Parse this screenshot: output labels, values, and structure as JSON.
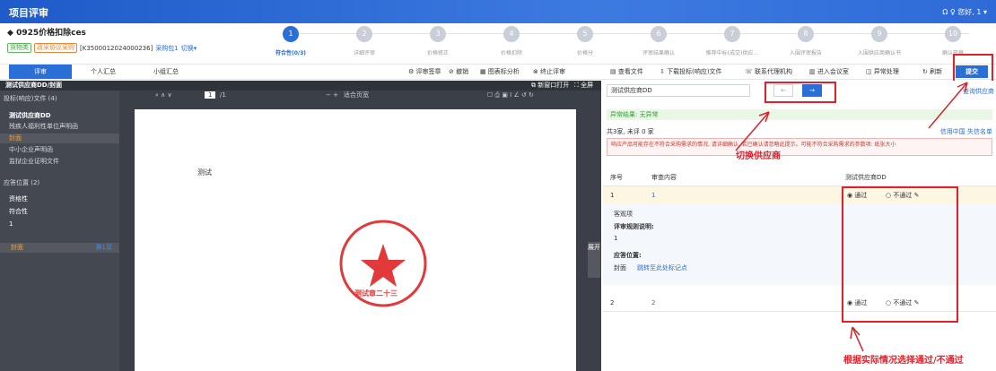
{
  "app": {
    "title": "项目评审",
    "user": "Ω  ♀ 您好, 1 ▾"
  },
  "project": {
    "name": "0925价格扣除ces",
    "tag1": "货物类",
    "tag2": "政采协议采购",
    "code": "[K3500012024000236]",
    "pack": "采购包1",
    "switch": "切换▾"
  },
  "steps": [
    {
      "n": "1",
      "label": "符合性(0/3)"
    },
    {
      "n": "2",
      "label": "详细评审"
    },
    {
      "n": "3",
      "label": "价格修正"
    },
    {
      "n": "4",
      "label": "价格扣除"
    },
    {
      "n": "5",
      "label": "价格分"
    },
    {
      "n": "6",
      "label": "评审结果确认"
    },
    {
      "n": "7",
      "label": "推荐中标(成交)供应..."
    },
    {
      "n": "8",
      "label": "入围评审报告"
    },
    {
      "n": "9",
      "label": "入围供应商确认书"
    },
    {
      "n": "10",
      "label": "确认签章"
    }
  ],
  "tabs": {
    "t1": "评审",
    "t2": "个人汇总",
    "t3": "小组汇总"
  },
  "toolbar": {
    "a": "评审签章",
    "b": "撤销",
    "c": "图表标分析",
    "d": "终止评审",
    "e": "查看文件",
    "f": "下载投标(响应)文件",
    "g": "联系代理机构",
    "h": "进入会议室",
    "i": "异常处理",
    "j": "刷新",
    "submit": "提交"
  },
  "viewer": {
    "title": "测试供应商DD/封面",
    "open": "新窗口打开",
    "full": "全屏",
    "page": "1",
    "total": "/1",
    "zoom": "适合页宽",
    "content": "测试"
  },
  "tree": {
    "files": "投标(响应)文件 (4)",
    "supplier": "测试供应商DD",
    "f1": "残疾人福利性单位声明函",
    "f2": "封面",
    "f3": "中小企业声明函",
    "f4": "监狱企业证明文件",
    "pos": "应答位置 (2)",
    "q1": "资格性",
    "q2": "符合性",
    "q3": "1",
    "q4": "封面",
    "q4r": "第1页"
  },
  "stamp": {
    "ring": "福建测试软件股份有限公司",
    "bottom": "测试章二十三"
  },
  "right": {
    "search": "测试供应商DD",
    "query": "查询供应商",
    "abn": "异常结果: 无异常",
    "count": "共3家, 未评 0 家",
    "links": "信用中国  失信名单",
    "warn": "响应产品可能存在不符合采购需求的情况, 请详细确认, 若已确认请忽略此提示。可能不符合采购需求的参数项: 纸张大小",
    "h1": "序号",
    "h2": "审查内容",
    "h3": "测试供应商DD",
    "r1": "1",
    "r1c": "1",
    "pass": "通过",
    "fail": "不通过",
    "obj": "客观项",
    "rule": "评审规则说明:",
    "one": "1",
    "pos": "应答位置:",
    "cover": "封面",
    "jump": "跳转至此处标记点",
    "r2": "2",
    "r2c": "2"
  },
  "notes": {
    "n1": "切换供应商",
    "n2": "根据实际情况选择通过/不通过",
    "side": "展开"
  }
}
